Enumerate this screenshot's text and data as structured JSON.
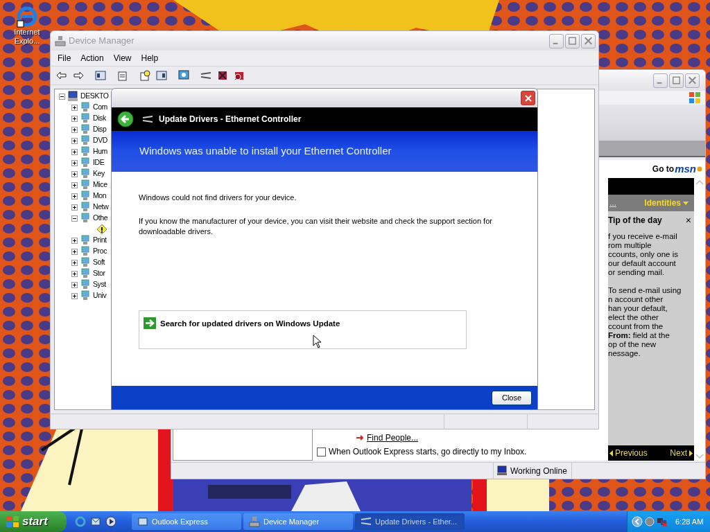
{
  "desktop": {
    "icons": [
      {
        "label": "Internet Explo..."
      }
    ]
  },
  "outlook_window": {
    "go_to": "Go to",
    "msn": "msn",
    "more_link": "...",
    "identities": "Identities",
    "tip_title": "Tip of the day",
    "tip_close": "×",
    "tip_paragraphs": [
      [
        "f you receive e-mail",
        "rom multiple",
        "ccounts, only one is",
        "our default account",
        "or sending mail."
      ],
      [
        "To send e-mail using",
        "n account other",
        "han your default,",
        "elect the other",
        "ccount from the",
        "**From:** field at the",
        "op of the new",
        "nessage."
      ]
    ],
    "previous": "Previous",
    "next": "Next",
    "find_people": "Find People...",
    "startup_checkbox": {
      "label": "When Outlook Express starts, go directly to my Inbox.",
      "checked": false
    },
    "status": "Working Online"
  },
  "device_manager": {
    "title": "Device Manager",
    "menu": [
      "File",
      "Action",
      "View",
      "Help"
    ],
    "tree": [
      {
        "label": "DESKTO",
        "expanded": true,
        "children": [
          {
            "label": "Com",
            "expanded": false
          },
          {
            "label": "Disk",
            "expanded": false
          },
          {
            "label": "Disp",
            "expanded": false
          },
          {
            "label": "DVD",
            "expanded": false
          },
          {
            "label": "Hum",
            "expanded": false
          },
          {
            "label": "IDE",
            "expanded": false
          },
          {
            "label": "Key",
            "expanded": false
          },
          {
            "label": "Mice",
            "expanded": false
          },
          {
            "label": "Mon",
            "expanded": false
          },
          {
            "label": "Netw",
            "expanded": false
          },
          {
            "label": "Othe",
            "expanded": true,
            "children": [
              {
                "kind": "warning"
              }
            ]
          },
          {
            "label": "Print",
            "expanded": false
          },
          {
            "label": "Proc",
            "expanded": false
          },
          {
            "label": "Soft",
            "expanded": false
          },
          {
            "label": "Stor",
            "expanded": false
          },
          {
            "label": "Syst",
            "expanded": false
          },
          {
            "label": "Univ",
            "expanded": false
          }
        ]
      }
    ]
  },
  "dialog": {
    "title": "Update Drivers - Ethernet Controller",
    "heading": "Windows was unable to install your Ethernet Controller",
    "paragraphs": [
      "Windows could not find drivers for your device.",
      "If you know the manufacturer of your device, you can visit their website and check the support section for downloadable drivers."
    ],
    "option": "Search for updated drivers on Windows Update",
    "close": "Close"
  },
  "taskbar": {
    "start": "start",
    "tasks": [
      {
        "label": "Outlook Express",
        "selected": false
      },
      {
        "label": "Device Manager",
        "selected": false
      },
      {
        "label": "Update Drivers - Ether...",
        "selected": true
      }
    ],
    "clock": "6:28 AM"
  }
}
